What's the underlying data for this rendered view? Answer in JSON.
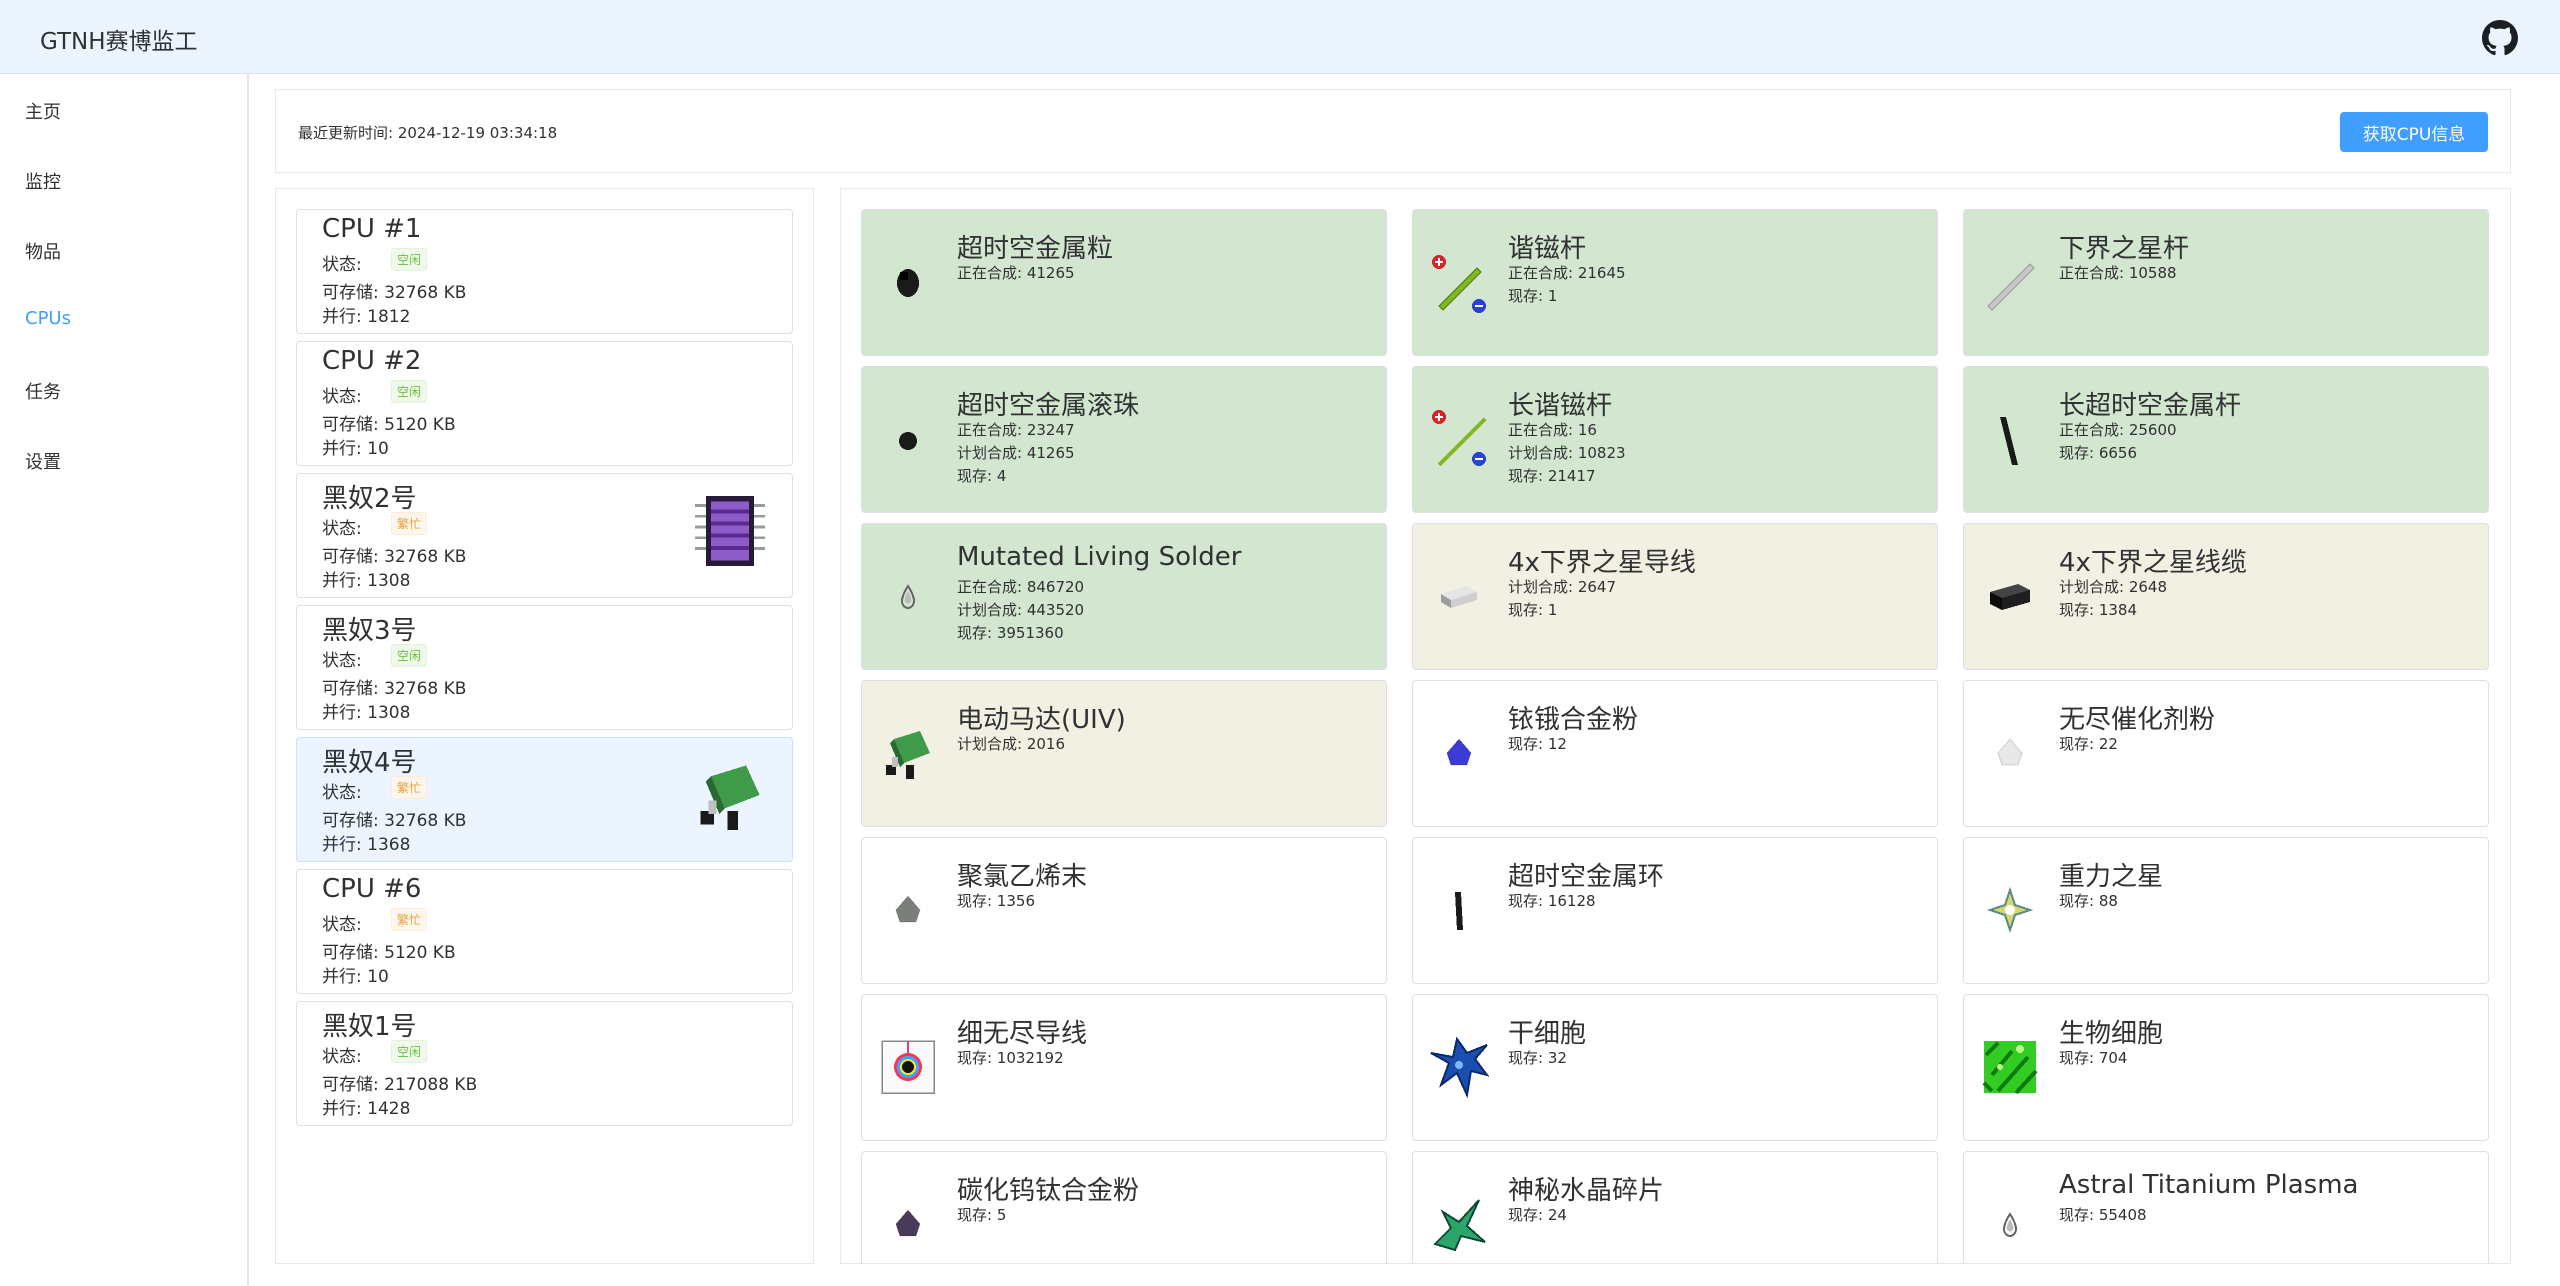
{
  "app": {
    "title": "GTNH赛博监工"
  },
  "sidebar": {
    "items": [
      {
        "label": "主页"
      },
      {
        "label": "监控"
      },
      {
        "label": "物品"
      },
      {
        "label": "CPUs"
      },
      {
        "label": "任务"
      },
      {
        "label": "设置"
      }
    ],
    "active": "CPUs"
  },
  "topbar": {
    "update_text": "最近更新时间: 2024-12-19 03:34:18",
    "fetch_button": "获取CPU信息"
  },
  "cpus": [
    {
      "name": "CPU #1",
      "status_label": "状态:",
      "status": "空闲",
      "storage": "可存储: 32768 KB",
      "parallel": "并行: 1812"
    },
    {
      "name": "CPU #2",
      "status_label": "状态:",
      "status": "空闲",
      "storage": "可存储: 5120 KB",
      "parallel": "并行: 10"
    },
    {
      "name": "黑奴2号",
      "status_label": "状态:",
      "status": "繁忙",
      "storage": "可存储: 32768 KB",
      "parallel": "并行: 1308",
      "icon": "processor-chip-icon"
    },
    {
      "name": "黑奴3号",
      "status_label": "状态:",
      "status": "空闲",
      "storage": "可存储: 32768 KB",
      "parallel": "并行: 1308"
    },
    {
      "name": "黑奴4号",
      "status_label": "状态:",
      "status": "繁忙",
      "storage": "可存储: 32768 KB",
      "parallel": "并行: 1368",
      "icon": "electric-motor-icon",
      "selected": true
    },
    {
      "name": "CPU #6",
      "status_label": "状态:",
      "status": "繁忙",
      "storage": "可存储: 5120 KB",
      "parallel": "并行: 10"
    },
    {
      "name": "黑奴1号",
      "status_label": "状态:",
      "status": "空闲",
      "storage": "可存储: 217088 KB",
      "parallel": "并行: 1428"
    }
  ],
  "items": [
    {
      "name": "超时空金属粒",
      "state": "crafting",
      "lines": [
        "正在合成: 41265"
      ],
      "icon": "nugget-icon",
      "color": "#1a1a1a"
    },
    {
      "name": "谐镃杆",
      "state": "crafting",
      "lines": [
        "正在合成: 21645",
        "现存: 1"
      ],
      "icon": "magnetic-rod-icon",
      "color": "#7fb820"
    },
    {
      "name": "下界之星杆",
      "state": "crafting",
      "lines": [
        "正在合成: 10588"
      ],
      "icon": "rod-icon",
      "color": "#c8c8c8"
    },
    {
      "name": "超时空金属滚珠",
      "state": "crafting",
      "lines": [
        "正在合成: 23247",
        "计划合成: 41265",
        "现存: 4"
      ],
      "icon": "ball-icon",
      "color": "#1a1a1a"
    },
    {
      "name": "长谐镃杆",
      "state": "crafting",
      "lines": [
        "正在合成: 16",
        "计划合成: 10823",
        "现存: 21417"
      ],
      "icon": "magnetic-long-rod-icon",
      "color": "#7fb820"
    },
    {
      "name": "长超时空金属杆",
      "state": "crafting",
      "lines": [
        "正在合成: 25600",
        "现存: 6656"
      ],
      "icon": "long-rod-icon",
      "color": "#1a1a1a"
    },
    {
      "name": "Mutated Living Solder",
      "state": "crafting",
      "lines": [
        "正在合成: 846720",
        "计划合成: 443520",
        "现存: 3951360"
      ],
      "icon": "fluid-drop-icon",
      "color": "#bbbbbb"
    },
    {
      "name": "4x下界之星导线",
      "state": "planned",
      "lines": [
        "计划合成: 2647",
        "现存: 1"
      ],
      "icon": "wire-icon",
      "color": "#cfcfcf"
    },
    {
      "name": "4x下界之星线缆",
      "state": "planned",
      "lines": [
        "计划合成: 2648",
        "现存: 1384"
      ],
      "icon": "cable-icon",
      "color": "#1e1e1e"
    },
    {
      "name": "电动马达(UIV)",
      "state": "planned",
      "lines": [
        "计划合成: 2016"
      ],
      "icon": "electric-motor-icon",
      "color": "#3f9a4a"
    },
    {
      "name": "铱锇合金粉",
      "state": "normal",
      "lines": [
        "现存: 12"
      ],
      "icon": "dust-icon",
      "color": "#3b3bd6"
    },
    {
      "name": "无尽催化剂粉",
      "state": "normal",
      "lines": [
        "现存: 22"
      ],
      "icon": "dust-icon",
      "color": "#e8e8e8"
    },
    {
      "name": "聚氯乙烯末",
      "state": "normal",
      "lines": [
        "现存: 1356"
      ],
      "icon": "dust-icon",
      "color": "#7a7f7a"
    },
    {
      "name": "超时空金属环",
      "state": "normal",
      "lines": [
        "现存: 16128"
      ],
      "icon": "ring-icon",
      "color": "#1a1a1a"
    },
    {
      "name": "重力之星",
      "state": "normal",
      "lines": [
        "现存: 88"
      ],
      "icon": "star-icon",
      "color": "#d8d86a"
    },
    {
      "name": "细无尽导线",
      "state": "normal",
      "lines": [
        "现存: 1032192"
      ],
      "icon": "fine-wire-icon",
      "color": "#e0407a"
    },
    {
      "name": "干细胞",
      "state": "normal",
      "lines": [
        "现存: 32"
      ],
      "icon": "stem-cell-icon",
      "color": "#1a4fb0"
    },
    {
      "name": "生物细胞",
      "state": "normal",
      "lines": [
        "现存: 704"
      ],
      "icon": "bio-cell-icon",
      "color": "#33cc22"
    },
    {
      "name": "碳化钨钛合金粉",
      "state": "normal",
      "lines": [
        "现存: 5"
      ],
      "icon": "dust-icon",
      "color": "#4a3a5a"
    },
    {
      "name": "神秘水晶碎片",
      "state": "normal",
      "lines": [
        "现存: 24"
      ],
      "icon": "crystal-shard-icon",
      "color": "#2aa66a"
    },
    {
      "name": "Astral Titanium Plasma",
      "state": "normal",
      "lines": [
        "现存: 55408"
      ],
      "icon": "fluid-drop-icon",
      "color": "#bbbbbb"
    }
  ]
}
